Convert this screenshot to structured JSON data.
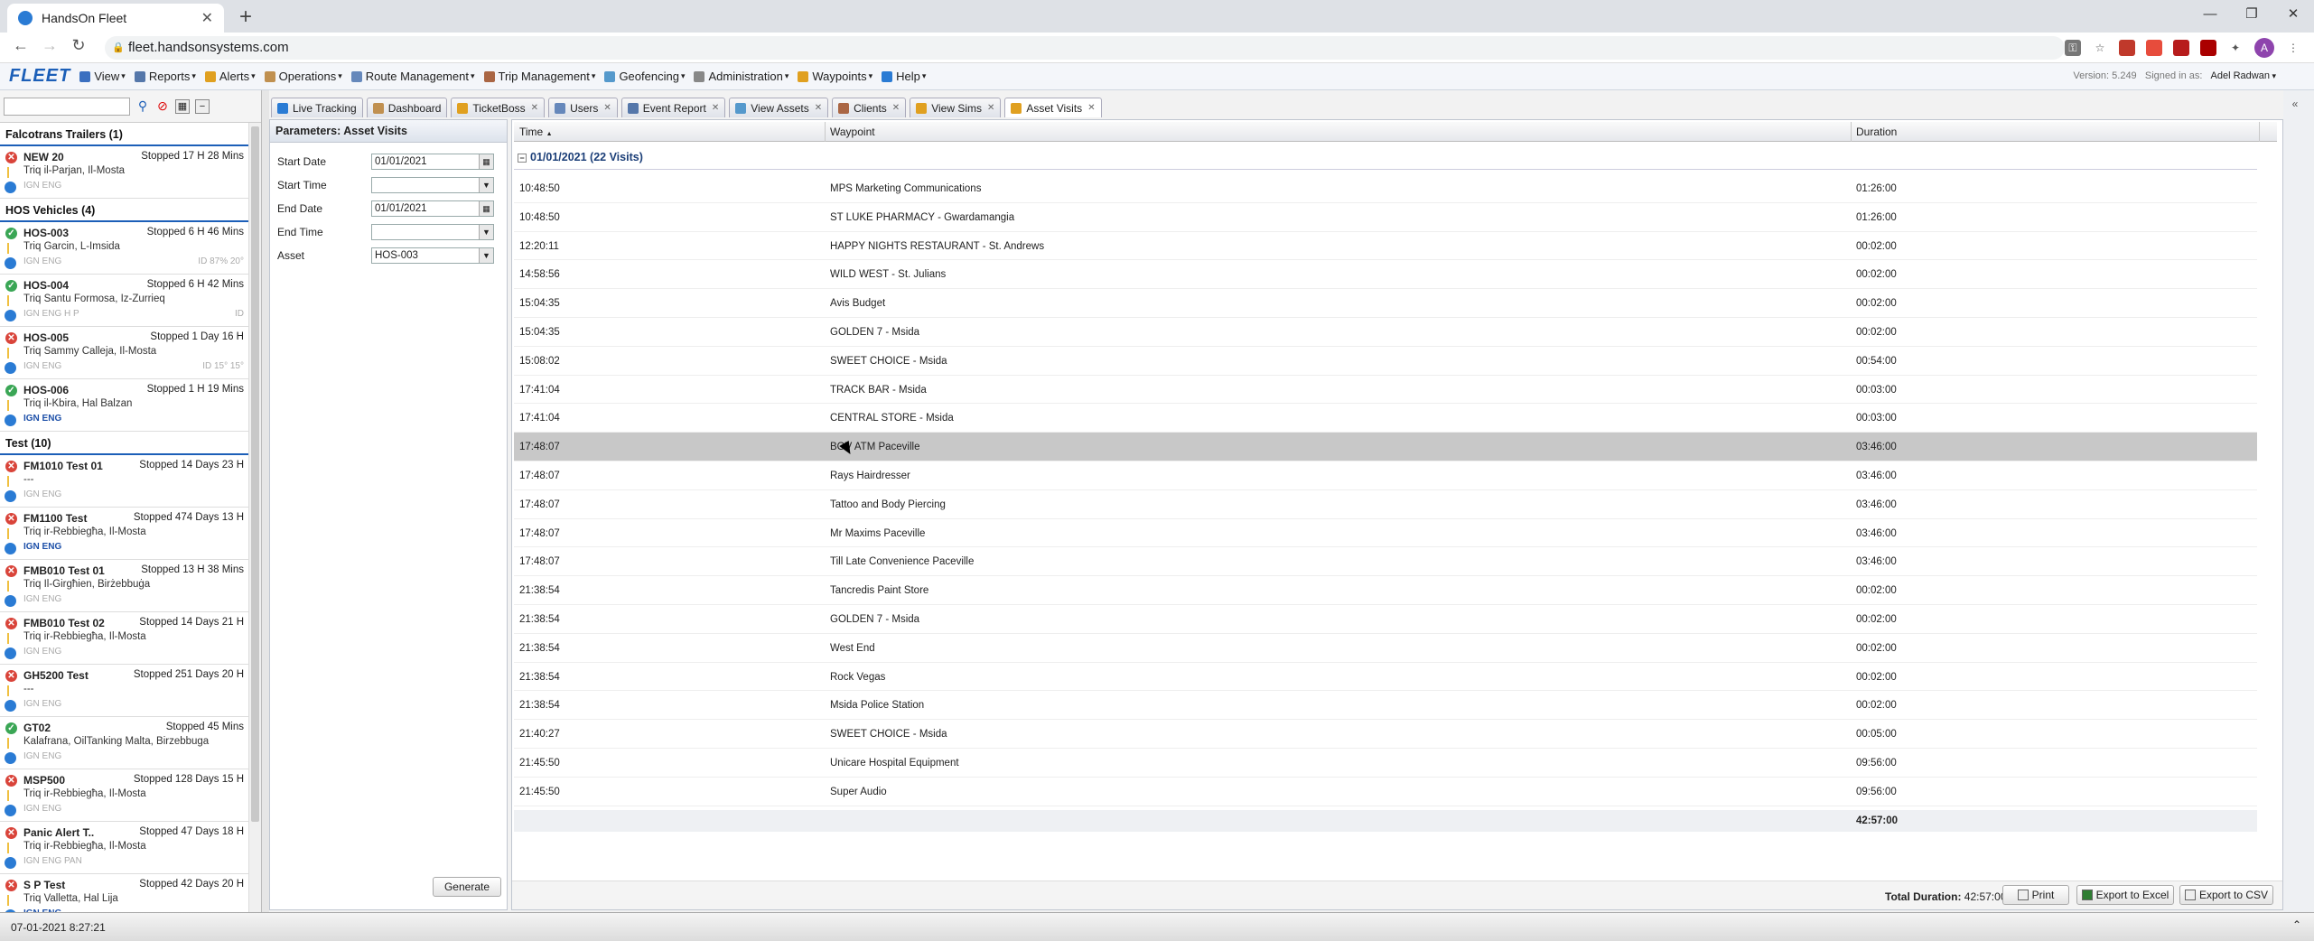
{
  "browser": {
    "tab_title": "HandsOn Fleet",
    "url": "fleet.handsonsystems.com",
    "new_tab": "+",
    "tab_close": "✕",
    "win_min": "—",
    "win_restore": "❐",
    "win_close": "✕",
    "avatar_letter": "A"
  },
  "app": {
    "logo": "FLEET",
    "menu": [
      {
        "label": "View",
        "color": "#3a6fc0"
      },
      {
        "label": "Reports",
        "color": "#5577aa"
      },
      {
        "label": "Alerts",
        "color": "#e0a020"
      },
      {
        "label": "Operations",
        "color": "#c09050"
      },
      {
        "label": "Route Management",
        "color": "#6688bb"
      },
      {
        "label": "Trip Management",
        "color": "#aa6644"
      },
      {
        "label": "Geofencing",
        "color": "#5599cc"
      },
      {
        "label": "Administration",
        "color": "#888888"
      },
      {
        "label": "Waypoints",
        "color": "#e0a020"
      },
      {
        "label": "Help",
        "color": "#2a7bd4"
      }
    ],
    "version": "Version: 5.249",
    "signed_in_label": "Signed in as:",
    "user": "Adel Radwan"
  },
  "vehicles": {
    "groups": [
      {
        "name": "Falcotrans Trailers (1)",
        "items": [
          {
            "name": "NEW 20",
            "status": "red",
            "stopped": "Stopped 17 H 28 Mins",
            "address": "Triq il-Parjan, Il-Mosta",
            "ign": "IGN ENG",
            "ign_on": false,
            "extra": ""
          }
        ]
      },
      {
        "name": "HOS Vehicles (4)",
        "items": [
          {
            "name": "HOS-003",
            "status": "green",
            "stopped": "Stopped 6 H 46 Mins",
            "address": "Triq Garcin, L-Imsida",
            "ign": "IGN ENG",
            "ign_on": false,
            "extra": "ID  87%  20°"
          },
          {
            "name": "HOS-004",
            "status": "green",
            "stopped": "Stopped 6 H 42 Mins",
            "address": "Triq Santu Formosa, Iz-Zurrieq",
            "ign": "IGN ENG H  P",
            "ign_on": false,
            "extra": "ID"
          },
          {
            "name": "HOS-005",
            "status": "red",
            "stopped": "Stopped 1 Day 16 H",
            "address": "Triq Sammy Calleja, Il-Mosta",
            "ign": "IGN ENG",
            "ign_on": false,
            "extra": "ID  15°  15°"
          },
          {
            "name": "HOS-006",
            "status": "green",
            "stopped": "Stopped 1 H 19 Mins",
            "address": "Triq il-Kbira, Hal Balzan",
            "ign": "IGN ENG",
            "ign_on": true,
            "extra": ""
          }
        ]
      },
      {
        "name": "Test (10)",
        "items": [
          {
            "name": "FM1010 Test 01",
            "status": "red",
            "stopped": "Stopped 14 Days 23 H",
            "address": "---",
            "ign": "IGN ENG",
            "ign_on": false,
            "extra": ""
          },
          {
            "name": "FM1100 Test",
            "status": "red",
            "stopped": "Stopped 474 Days 13 H",
            "address": "Triq ir-Rebbiegħa, Il-Mosta",
            "ign": "IGN ENG",
            "ign_on": true,
            "extra": ""
          },
          {
            "name": "FMB010 Test 01",
            "status": "red",
            "stopped": "Stopped 13 H 38 Mins",
            "address": "Triq Il-Girgħien, Birżebbuġa",
            "ign": "IGN ENG",
            "ign_on": false,
            "extra": ""
          },
          {
            "name": "FMB010 Test 02",
            "status": "red",
            "stopped": "Stopped 14 Days 21 H",
            "address": "Triq ir-Rebbiegħa, Il-Mosta",
            "ign": "IGN ENG",
            "ign_on": false,
            "extra": ""
          },
          {
            "name": "GH5200 Test",
            "status": "red",
            "stopped": "Stopped 251 Days 20 H",
            "address": "---",
            "ign": "IGN ENG",
            "ign_on": false,
            "extra": ""
          },
          {
            "name": "GT02",
            "status": "green",
            "stopped": "Stopped 45 Mins",
            "address": "Kalafrana, OilTanking Malta, Birzebbuga",
            "ign": "IGN ENG",
            "ign_on": false,
            "extra": ""
          },
          {
            "name": "MSP500",
            "status": "red",
            "stopped": "Stopped 128 Days 15 H",
            "address": "Triq ir-Rebbiegħa, Il-Mosta",
            "ign": "IGN ENG",
            "ign_on": false,
            "extra": ""
          },
          {
            "name": "Panic Alert T..",
            "status": "red",
            "stopped": "Stopped 47 Days 18 H",
            "address": "Triq ir-Rebbiegħa, Il-Mosta",
            "ign": "IGN ENG PAN",
            "ign_on": false,
            "extra": ""
          },
          {
            "name": "S P Test",
            "status": "red",
            "stopped": "Stopped 42 Days 20 H",
            "address": "Triq Valletta, Hal Lija",
            "ign": "IGN ENG",
            "ign_on": true,
            "extra": ""
          }
        ]
      }
    ]
  },
  "tabs": [
    {
      "label": "Live Tracking",
      "color": "#2a7bd4",
      "closable": false
    },
    {
      "label": "Dashboard",
      "color": "#c09050",
      "closable": false
    },
    {
      "label": "TicketBoss",
      "color": "#e0a020",
      "closable": true
    },
    {
      "label": "Users",
      "color": "#6688bb",
      "closable": true
    },
    {
      "label": "Event Report",
      "color": "#5577aa",
      "closable": true
    },
    {
      "label": "View Assets",
      "color": "#5599cc",
      "closable": true
    },
    {
      "label": "Clients",
      "color": "#aa6644",
      "closable": true
    },
    {
      "label": "View Sims",
      "color": "#e0a020",
      "closable": true
    },
    {
      "label": "Asset Visits",
      "color": "#e0a020",
      "closable": true,
      "active": true
    }
  ],
  "params": {
    "title": "Parameters: Asset Visits",
    "start_date_label": "Start Date",
    "start_date": "01/01/2021",
    "start_time_label": "Start Time",
    "start_time": "",
    "end_date_label": "End Date",
    "end_date": "01/01/2021",
    "end_time_label": "End Time",
    "end_time": "",
    "asset_label": "Asset",
    "asset": "HOS-003",
    "generate": "Generate"
  },
  "results": {
    "columns": [
      "Time",
      "Waypoint",
      "Duration"
    ],
    "sort_indicator": "▲",
    "group_label": "01/01/2021 (22 Visits)",
    "rows": [
      {
        "time": "10:48:50",
        "waypoint": "MPS Marketing Communications",
        "duration": "01:26:00"
      },
      {
        "time": "10:48:50",
        "waypoint": "ST LUKE PHARMACY - Gwardamangia",
        "duration": "01:26:00"
      },
      {
        "time": "12:20:11",
        "waypoint": "HAPPY NIGHTS RESTAURANT - St. Andrews",
        "duration": "00:02:00"
      },
      {
        "time": "14:58:56",
        "waypoint": "WILD WEST - St. Julians",
        "duration": "00:02:00"
      },
      {
        "time": "15:04:35",
        "waypoint": "Avis Budget",
        "duration": "00:02:00"
      },
      {
        "time": "15:04:35",
        "waypoint": "GOLDEN 7 - Msida",
        "duration": "00:02:00"
      },
      {
        "time": "15:08:02",
        "waypoint": "SWEET CHOICE - Msida",
        "duration": "00:54:00"
      },
      {
        "time": "17:41:04",
        "waypoint": "TRACK BAR - Msida",
        "duration": "00:03:00"
      },
      {
        "time": "17:41:04",
        "waypoint": "CENTRAL STORE - Msida",
        "duration": "00:03:00"
      },
      {
        "time": "17:48:07",
        "waypoint": "BOV ATM Paceville",
        "duration": "03:46:00",
        "selected": true
      },
      {
        "time": "17:48:07",
        "waypoint": "Rays Hairdresser",
        "duration": "03:46:00"
      },
      {
        "time": "17:48:07",
        "waypoint": "Tattoo and Body Piercing",
        "duration": "03:46:00"
      },
      {
        "time": "17:48:07",
        "waypoint": "Mr Maxims Paceville",
        "duration": "03:46:00"
      },
      {
        "time": "17:48:07",
        "waypoint": "Till Late Convenience Paceville",
        "duration": "03:46:00"
      },
      {
        "time": "21:38:54",
        "waypoint": "Tancredis Paint Store",
        "duration": "00:02:00"
      },
      {
        "time": "21:38:54",
        "waypoint": "GOLDEN 7 - Msida",
        "duration": "00:02:00"
      },
      {
        "time": "21:38:54",
        "waypoint": "West End",
        "duration": "00:02:00"
      },
      {
        "time": "21:38:54",
        "waypoint": "Rock Vegas",
        "duration": "00:02:00"
      },
      {
        "time": "21:38:54",
        "waypoint": "Msida Police Station",
        "duration": "00:02:00"
      },
      {
        "time": "21:40:27",
        "waypoint": "SWEET CHOICE - Msida",
        "duration": "00:05:00"
      },
      {
        "time": "21:45:50",
        "waypoint": "Unicare Hospital Equipment",
        "duration": "09:56:00"
      },
      {
        "time": "21:45:50",
        "waypoint": "Super Audio",
        "duration": "09:56:00"
      }
    ],
    "group_total": "42:57:00",
    "total_label": "Total Duration:",
    "total_value": "42:57:00",
    "print": "Print",
    "export_excel": "Export to Excel",
    "export_csv": "Export to CSV"
  },
  "status": {
    "datetime": "07-01-2021 8:27:21"
  }
}
